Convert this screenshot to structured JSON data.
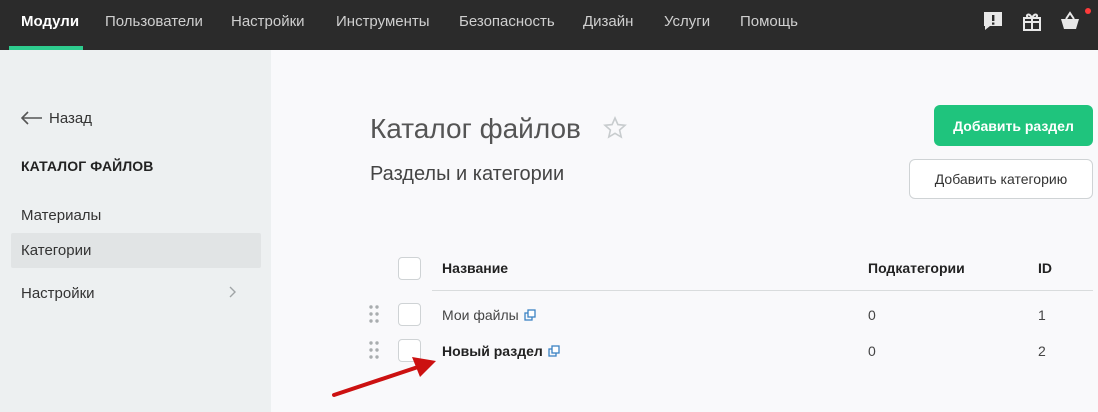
{
  "topnav": {
    "items": [
      "Модули",
      "Пользователи",
      "Настройки",
      "Инструменты",
      "Безопасность",
      "Дизайн",
      "Услуги",
      "Помощь"
    ],
    "active_index": 0,
    "icons": [
      "alert-message-icon",
      "gift-icon",
      "cart-icon"
    ],
    "accent_color": "#2ecc8e"
  },
  "sidebar": {
    "back_label": "Назад",
    "heading": "КАТАЛОГ ФАЙЛОВ",
    "items": [
      {
        "label": "Материалы",
        "active": false,
        "has_chevron": false
      },
      {
        "label": "Категории",
        "active": true,
        "has_chevron": false
      },
      {
        "label": "Настройки",
        "active": false,
        "has_chevron": true
      }
    ]
  },
  "main": {
    "title": "Каталог файлов",
    "subtitle": "Разделы и категории",
    "add_section_label": "Добавить раздел",
    "add_category_label": "Добавить категорию",
    "primary_color": "#1fc47d"
  },
  "table": {
    "columns": [
      "Название",
      "Подкатегории",
      "ID"
    ],
    "rows": [
      {
        "name": "Мои файлы",
        "subcategories": "0",
        "id": "1",
        "bold": false
      },
      {
        "name": "Новый раздел",
        "subcategories": "0",
        "id": "2",
        "bold": true
      }
    ]
  },
  "annotation": {
    "arrow_color": "#cc1111"
  }
}
